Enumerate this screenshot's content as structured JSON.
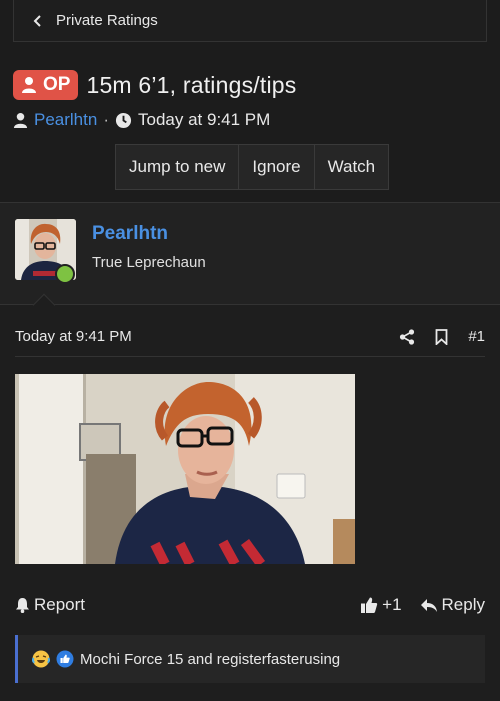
{
  "breadcrumb": {
    "label": "Private Ratings"
  },
  "thread": {
    "op_badge": "OP",
    "title": "15m 6’1, ratings/tips",
    "author": "Pearlhtn",
    "separator": "·",
    "time": "Today at 9:41 PM"
  },
  "actions": {
    "jump": "Jump to new",
    "ignore": "Ignore",
    "watch": "Watch"
  },
  "post": {
    "username": "Pearlhtn",
    "user_title": "True Leprechaun",
    "date": "Today at 9:41 PM",
    "post_number": "#1",
    "report": "Report",
    "like_count": "+1",
    "reply": "Reply",
    "reactions_text": "Mochi Force 15 and registerfasterusing"
  },
  "colors": {
    "background": "#1c1c1c",
    "accent_blue": "#4a90e2",
    "op_badge": "#e05347",
    "online": "#7ec242"
  },
  "icons": {
    "back": "chevron-left-icon",
    "op": "user-icon",
    "author": "user-icon",
    "time": "clock-icon",
    "share": "share-icon",
    "bookmark": "bookmark-icon",
    "report": "bell-icon",
    "like": "thumbs-up-icon",
    "reply": "reply-icon"
  }
}
